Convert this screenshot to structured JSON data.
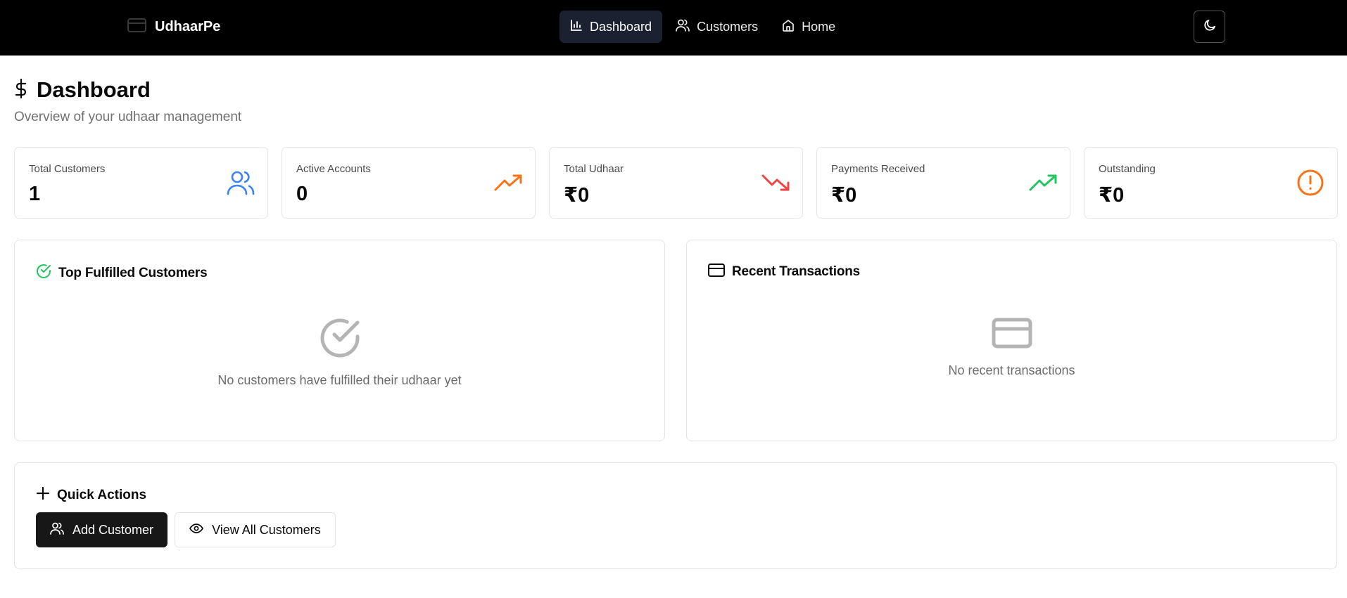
{
  "app": {
    "brand": "UdhaarPe"
  },
  "nav": {
    "items": [
      {
        "label": "Dashboard",
        "icon": "bar-chart-icon",
        "active": true
      },
      {
        "label": "Customers",
        "icon": "users-icon",
        "active": false
      },
      {
        "label": "Home",
        "icon": "home-icon",
        "active": false
      }
    ],
    "theme_toggle_icon": "moon-icon"
  },
  "header": {
    "title": "Dashboard",
    "subtitle": "Overview of your udhaar management",
    "icon": "dollar-icon"
  },
  "stats": [
    {
      "label": "Total Customers",
      "value": "1",
      "icon": "users-icon",
      "color": "#3b82f6"
    },
    {
      "label": "Active Accounts",
      "value": "0",
      "icon": "trending-up-icon",
      "color": "#f97316"
    },
    {
      "label": "Total Udhaar",
      "value": "₹0",
      "icon": "trending-down-icon",
      "color": "#ef4444"
    },
    {
      "label": "Payments Received",
      "value": "₹0",
      "icon": "trending-up-icon",
      "color": "#22c55e"
    },
    {
      "label": "Outstanding",
      "value": "₹0",
      "icon": "alert-circle-icon",
      "color": "#f97316"
    }
  ],
  "panels": {
    "top_fulfilled": {
      "title": "Top Fulfilled Customers",
      "icon": "check-circle-icon",
      "icon_color": "#22c55e",
      "empty_text": "No customers have fulfilled their udhaar yet"
    },
    "recent_transactions": {
      "title": "Recent Transactions",
      "icon": "credit-card-icon",
      "empty_text": "No recent transactions"
    }
  },
  "quick_actions": {
    "title": "Quick Actions",
    "add_customer": "Add Customer",
    "view_all": "View All Customers"
  }
}
